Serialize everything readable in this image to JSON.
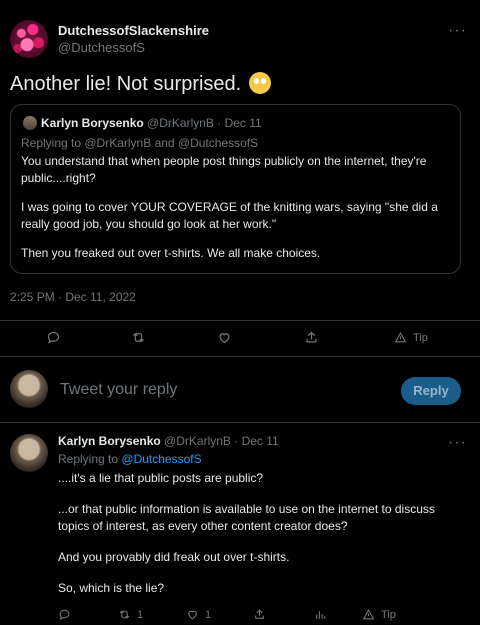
{
  "tweet": {
    "display_name": "DutchessofSlackenshire",
    "handle": "@DutchessofS",
    "text": "Another lie!  Not surprised.",
    "timestamp": "2:25 PM · Dec 11, 2022"
  },
  "quote": {
    "display_name": "Karlyn Borysenko",
    "meta": "@DrKarlynB · Dec 11",
    "replying_to": "Replying to @DrKarlynB and @DutchessofS",
    "paragraphs": [
      "You understand that when people post things publicly on the internet, they're public....right?",
      "I was going to cover YOUR COVERAGE of the knitting wars, saying \"she did a really good job, you should go look at her work.\"",
      "Then you freaked out over t-shirts. We all make choices."
    ]
  },
  "actions": {
    "tip_label": "Tip"
  },
  "composer": {
    "placeholder": "Tweet your reply",
    "reply_label": "Reply"
  },
  "reply": {
    "display_name": "Karlyn Borysenko",
    "meta": "@DrKarlynB · Dec 11",
    "replying_prefix": "Replying to",
    "replying_handle": "@DutchessofS",
    "paragraphs": [
      "....it's a lie that public posts are public?",
      "...or that public information is available to use on the internet to discuss topics of interest, as every other content creator does?",
      "And you provably did freak out over t-shirts.",
      "So, which is the lie?"
    ],
    "retweet_count": "1",
    "like_count": "1",
    "tip_label": "Tip"
  },
  "colors": {
    "background": "#000000",
    "text": "#e7e9ea",
    "muted": "#71767b",
    "link": "#1d9bf0",
    "border": "#2f3336"
  }
}
